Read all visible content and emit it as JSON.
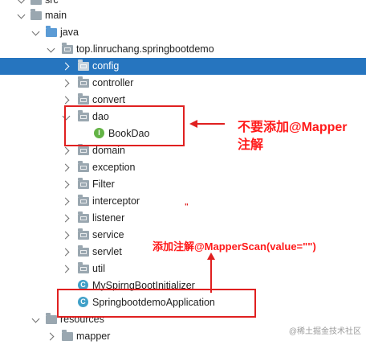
{
  "tree": {
    "src_label": "src",
    "main_label": "main",
    "java_label": "java",
    "package_label": "top.linruchang.springbootdemo",
    "packages": [
      "config",
      "controller",
      "convert",
      "dao",
      "domain",
      "exception",
      "Filter",
      "interceptor",
      "listener",
      "service",
      "servlet",
      "util"
    ],
    "dao_child": "BookDao",
    "classes": [
      "MySpirngBootInitializer",
      "SpringbootdemoApplication"
    ],
    "resources_label": "resources",
    "mapper_label": "mapper"
  },
  "annotations": {
    "note_dao_line1": "不要添加@Mapper",
    "note_dao_line2": "注解",
    "note_app": "添加注解@MapperScan(value=\"\")",
    "stray_mark": "\""
  },
  "watermark": "@稀土掘金技术社区",
  "colors": {
    "selected_bg": "#2675bf",
    "annotation_red": "#e02020"
  }
}
